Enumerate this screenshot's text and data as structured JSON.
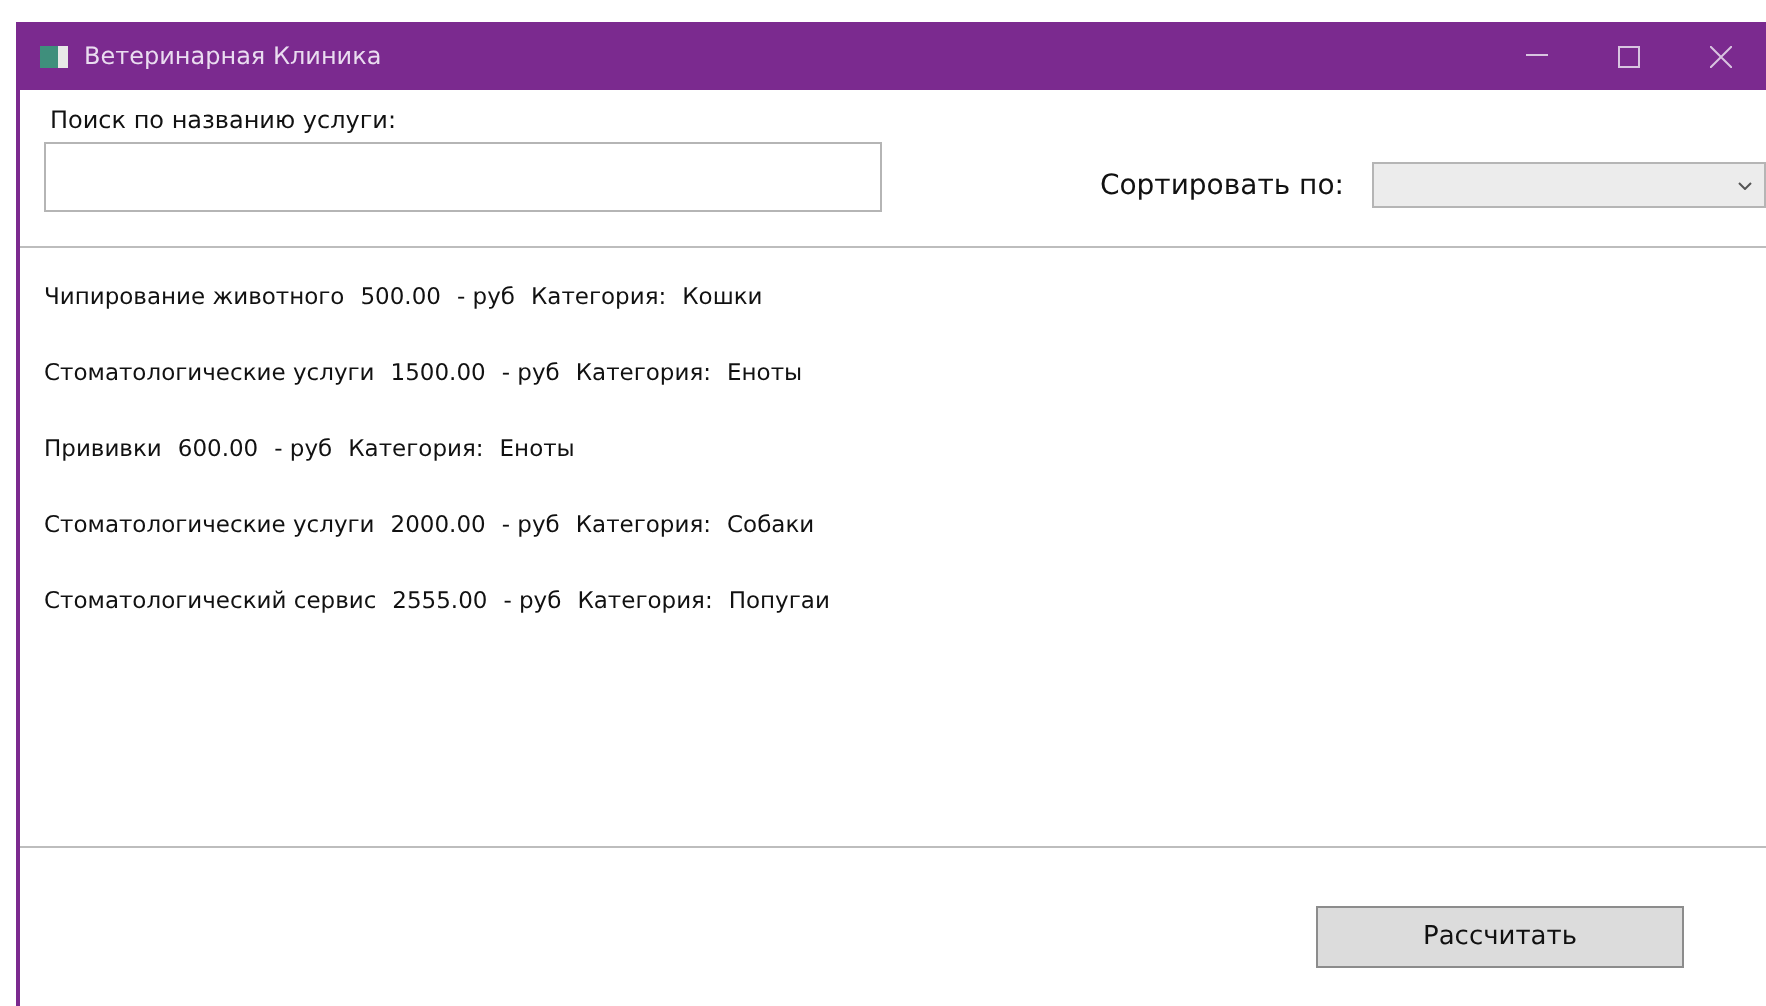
{
  "window": {
    "title": "Ветеринарная Клиника"
  },
  "search": {
    "label": "Поиск по названию услуги:"
  },
  "sort": {
    "label": "Сортировать по:"
  },
  "services": [
    {
      "name": "Чипирование животного",
      "price": "500.00",
      "currency": "- руб",
      "category_label": "Категория:",
      "category": "Кошки"
    },
    {
      "name": "Стоматологические услуги",
      "price": "1500.00",
      "currency": "- руб",
      "category_label": "Категория:",
      "category": "Еноты"
    },
    {
      "name": "Прививки",
      "price": "600.00",
      "currency": "- руб",
      "category_label": "Категория:",
      "category": "Еноты"
    },
    {
      "name": "Стоматологические услуги",
      "price": "2000.00",
      "currency": "- руб",
      "category_label": "Категория:",
      "category": "Собаки"
    },
    {
      "name": "Стоматологический сервис",
      "price": "2555.00",
      "currency": "- руб",
      "category_label": "Категория:",
      "category": "Попугаи"
    }
  ],
  "buttons": [
    {
      "label": "Рассчитать"
    }
  ]
}
